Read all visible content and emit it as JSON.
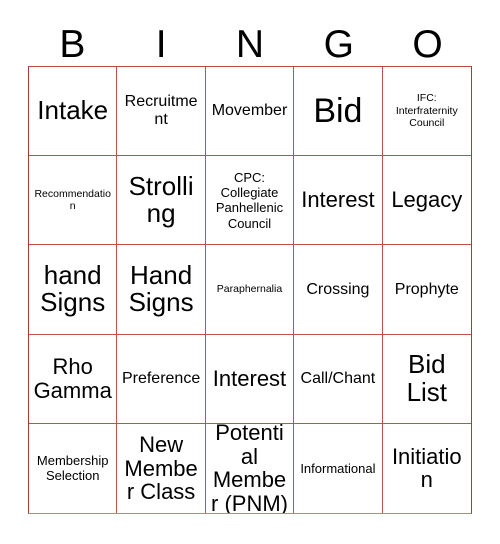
{
  "card": {
    "title": "BINGO",
    "header_letters": [
      "B",
      "I",
      "N",
      "G",
      "O"
    ],
    "border_color": "#c0504d",
    "text_color": "#000000",
    "background_color": "#ffffff",
    "rows": 5,
    "columns": 5,
    "cells": [
      {
        "text": "Intake",
        "size": "xl"
      },
      {
        "text": "Recruitment",
        "size": "md"
      },
      {
        "text": "Movember",
        "size": "md"
      },
      {
        "text": "Bid",
        "size": "xxl"
      },
      {
        "text": "IFC: Interfraternity Council",
        "size": "xs"
      },
      {
        "text": "Recommendation",
        "size": "xs"
      },
      {
        "text": "Strolling",
        "size": "xl"
      },
      {
        "text": "CPC: Collegiate Panhellenic Council",
        "size": "sm"
      },
      {
        "text": "Interest",
        "size": "lg"
      },
      {
        "text": "Legacy",
        "size": "lg"
      },
      {
        "text": "hand Signs",
        "size": "xl"
      },
      {
        "text": "Hand Signs",
        "size": "xl"
      },
      {
        "text": "Paraphernalia",
        "size": "xs"
      },
      {
        "text": "Crossing",
        "size": "md"
      },
      {
        "text": "Prophyte",
        "size": "md"
      },
      {
        "text": "Rho Gamma",
        "size": "lg"
      },
      {
        "text": "Preference",
        "size": "md"
      },
      {
        "text": "Interest",
        "size": "lg"
      },
      {
        "text": "Call/Chant",
        "size": "md"
      },
      {
        "text": "Bid List",
        "size": "xl"
      },
      {
        "text": "Membership Selection",
        "size": "sm"
      },
      {
        "text": "New Member Class",
        "size": "lg"
      },
      {
        "text": "Potential Member (PNM)",
        "size": "lg"
      },
      {
        "text": "Informational",
        "size": "sm"
      },
      {
        "text": "Initiation",
        "size": "lg"
      }
    ]
  }
}
